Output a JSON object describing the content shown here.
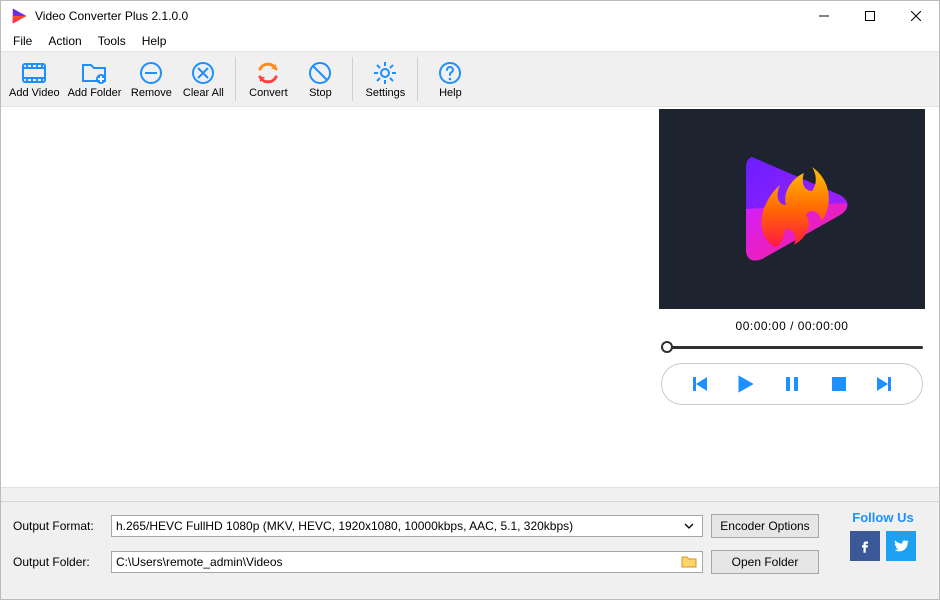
{
  "window": {
    "title": "Video Converter Plus 2.1.0.0"
  },
  "menu": {
    "items": [
      "File",
      "Action",
      "Tools",
      "Help"
    ]
  },
  "toolbar": {
    "add_video": "Add Video",
    "add_folder": "Add Folder",
    "remove": "Remove",
    "clear_all": "Clear All",
    "convert": "Convert",
    "stop": "Stop",
    "settings": "Settings",
    "help": "Help"
  },
  "preview": {
    "timecode": "00:00:00 / 00:00:00"
  },
  "output": {
    "format_label": "Output Format:",
    "format_value": "h.265/HEVC FullHD 1080p (MKV, HEVC, 1920x1080, 10000kbps, AAC, 5.1, 320kbps)",
    "folder_label": "Output Folder:",
    "folder_value": "C:\\Users\\remote_admin\\Videos",
    "encoder_options": "Encoder Options",
    "open_folder": "Open Folder"
  },
  "follow": {
    "title": "Follow Us"
  }
}
